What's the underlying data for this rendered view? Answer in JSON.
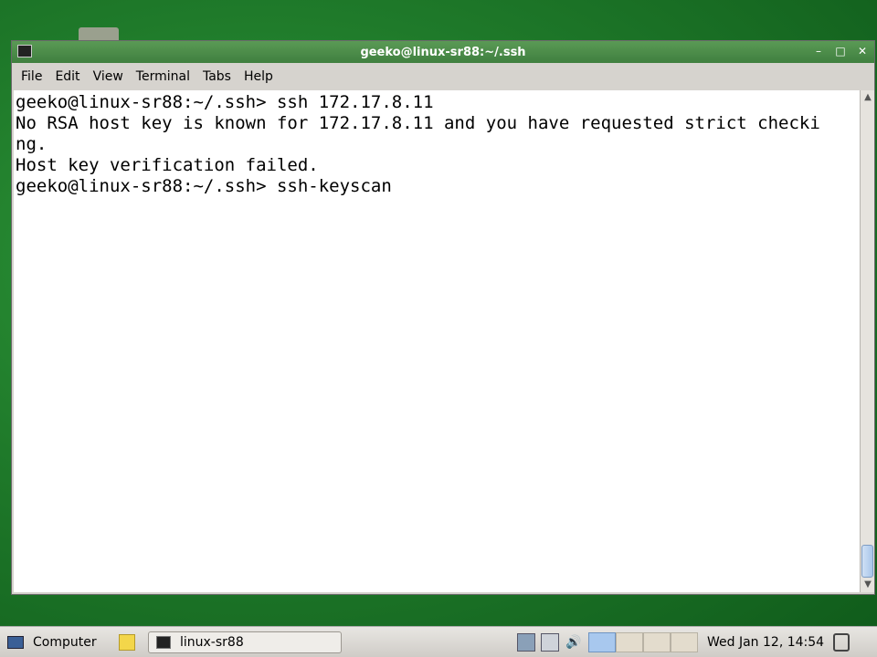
{
  "window": {
    "title": "geeko@linux-sr88:~/.ssh",
    "icon": "terminal-icon",
    "controls": [
      "minimize-icon",
      "maximize-icon",
      "close-icon"
    ]
  },
  "menubar": {
    "items": [
      "File",
      "Edit",
      "View",
      "Terminal",
      "Tabs",
      "Help"
    ]
  },
  "terminal": {
    "lines": [
      "geeko@linux-sr88:~/.ssh> ssh 172.17.8.11",
      "No RSA host key is known for 172.17.8.11 and you have requested strict checki",
      "ng.",
      "Host key verification failed.",
      "geeko@linux-sr88:~/.ssh> ssh-keyscan"
    ]
  },
  "taskbar": {
    "computer_label": "Computer",
    "task_label": "linux-sr88",
    "clock": "Wed Jan 12, 14:54"
  }
}
